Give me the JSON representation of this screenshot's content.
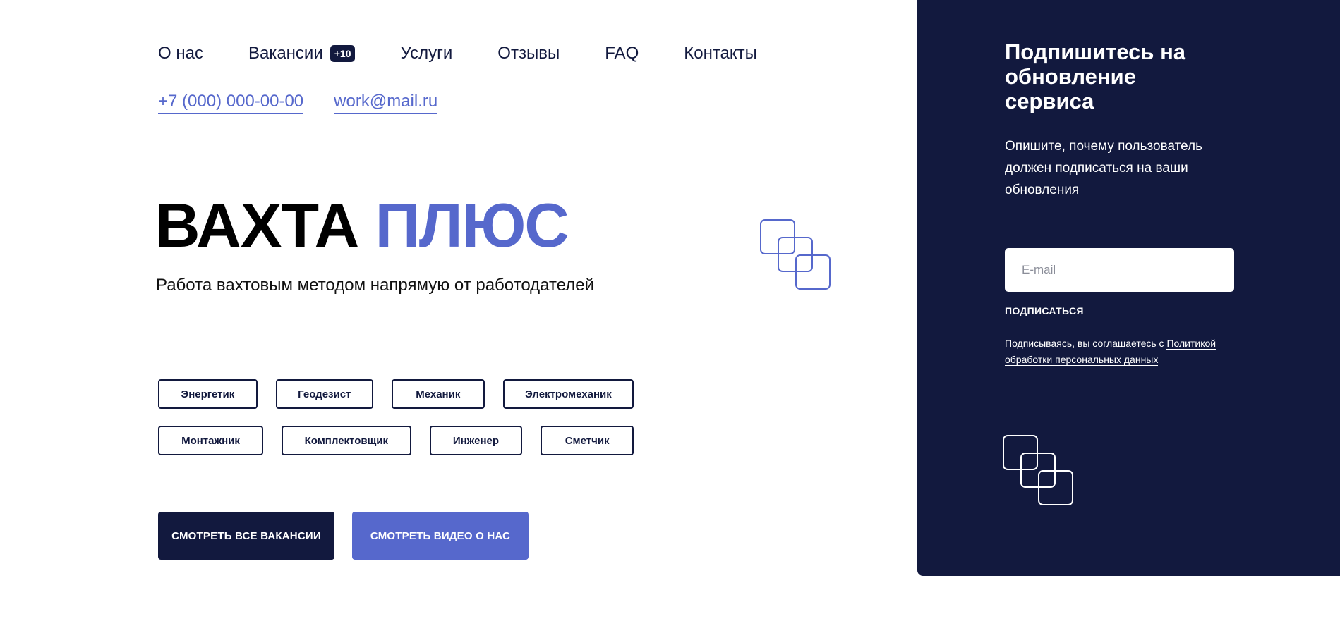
{
  "nav": {
    "items": [
      {
        "label": "О нас"
      },
      {
        "label": "Вакансии",
        "badge": "+10"
      },
      {
        "label": "Услуги"
      },
      {
        "label": "Отзывы"
      },
      {
        "label": "FAQ"
      },
      {
        "label": "Контакты"
      }
    ]
  },
  "contacts": {
    "phone": "+7 (000) 000-00-00",
    "email": "work@mail.ru"
  },
  "hero": {
    "title_dark": "ВАХТА",
    "title_accent": "ПЛЮС",
    "subtitle": "Работа вахтовым методом напрямую от работодателей"
  },
  "tags": {
    "row1": [
      "Энергетик",
      "Геодезист",
      "Механик",
      "Электромеханик"
    ],
    "row2": [
      "Монтажник",
      "Комплектовщик",
      "Инженер",
      "Сметчик"
    ]
  },
  "buttons": {
    "all_vacancies": "СМОТРЕТЬ ВСЕ ВАКАНСИИ",
    "watch_video": "СМОТРЕТЬ ВИДЕО О НАС"
  },
  "subscribe_panel": {
    "title": "Подпишитесь на обновление сервиса",
    "description": "Опишите, почему пользователь должен подписаться на ваши обновления",
    "email_placeholder": "E-mail",
    "subscribe_label": "ПОДПИСАТЬСЯ",
    "consent_prefix": "Подписываясь, вы соглашаетесь с ",
    "consent_link": "Политикой обработки персональных данных"
  },
  "colors": {
    "navy": "#12193e",
    "accent": "#5668cc",
    "white": "#ffffff"
  },
  "icons": {
    "decor": "overlapping-squares-icon"
  }
}
